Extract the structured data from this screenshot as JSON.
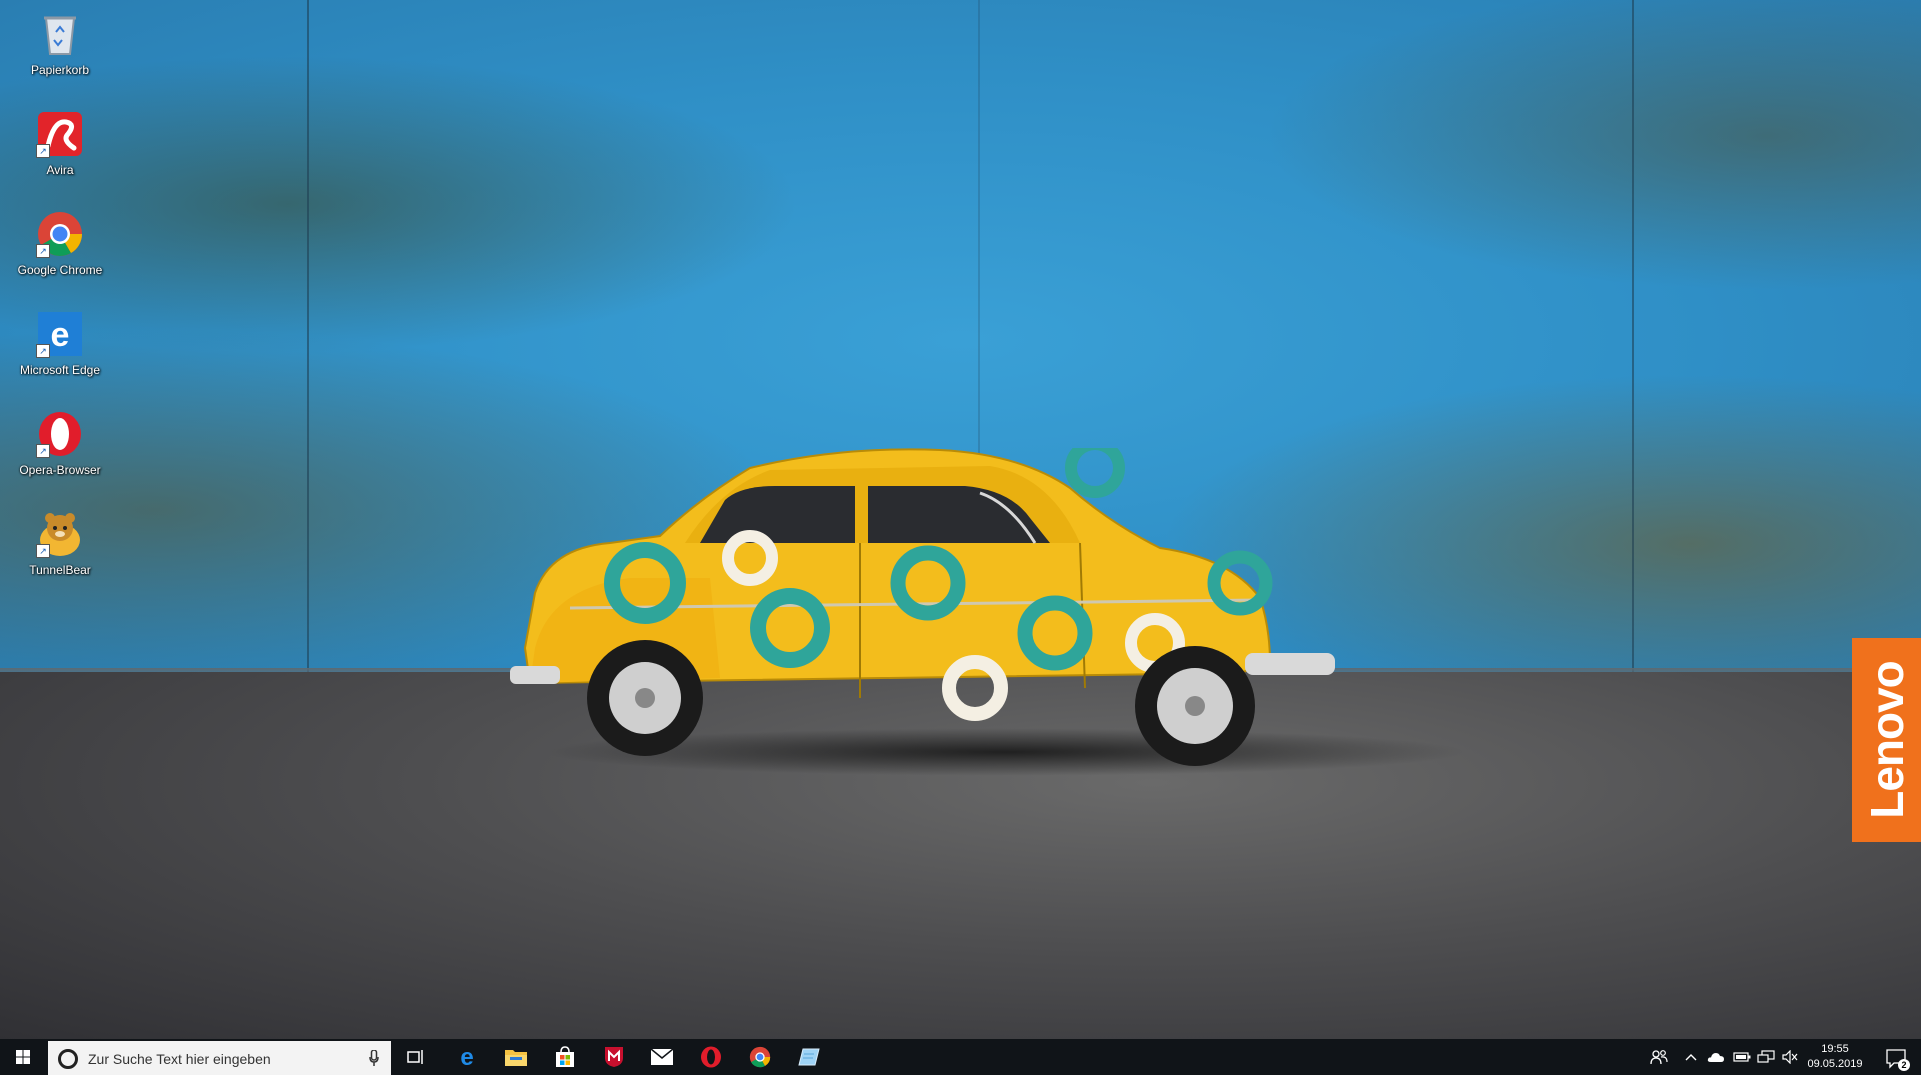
{
  "desktop": {
    "icons": [
      {
        "label": "Papierkorb",
        "icon": "recycle-bin-icon"
      },
      {
        "label": "Avira",
        "icon": "avira-icon"
      },
      {
        "label": "Google Chrome",
        "icon": "chrome-icon"
      },
      {
        "label": "Microsoft Edge",
        "icon": "edge-icon"
      },
      {
        "label": "Opera-Browser",
        "icon": "opera-icon"
      },
      {
        "label": "TunnelBear",
        "icon": "tunnelbear-icon"
      }
    ],
    "brand_tab": "Lenovo"
  },
  "taskbar": {
    "search_placeholder": "Zur Suche Text hier eingeben",
    "pinned": [
      "task-view-icon",
      "edge-icon",
      "file-explorer-icon",
      "store-icon",
      "mcafee-icon",
      "mail-icon",
      "opera-icon",
      "chrome-icon",
      "notepad-icon"
    ],
    "tray": [
      "people-icon",
      "chevron-up-icon",
      "onedrive-icon",
      "battery-icon",
      "network-icon",
      "volume-muted-icon"
    ],
    "clock": {
      "time": "19:55",
      "date": "09.05.2019"
    },
    "notification_count": "2"
  },
  "colors": {
    "wall": "#2f8fc6",
    "car": "#f3bd1c",
    "taskbar": "#101418",
    "lenovo": "#f0711c"
  }
}
